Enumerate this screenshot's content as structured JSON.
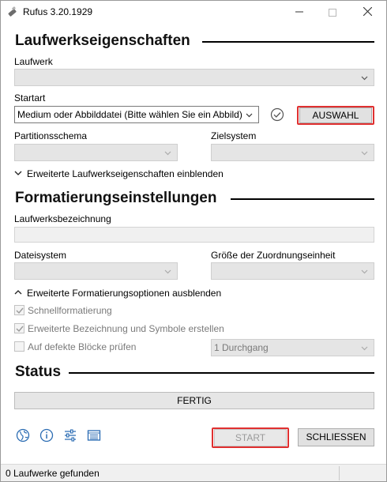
{
  "window": {
    "title": "Rufus 3.20.1929"
  },
  "drive_properties": {
    "heading": "Laufwerkseigenschaften",
    "device_label": "Laufwerk",
    "device_value": "",
    "boot_label": "Startart",
    "boot_value": "Medium oder Abbilddatei (Bitte wählen Sie ein Abbild)",
    "select_button": "AUSWAHL",
    "partition_label": "Partitionsschema",
    "target_label": "Zielsystem",
    "advanced_toggle": "Erweiterte Laufwerkseigenschaften einblenden"
  },
  "format_options": {
    "heading": "Formatierungseinstellungen",
    "volume_label": "Laufwerksbezeichnung",
    "volume_value": "",
    "filesystem_label": "Dateisystem",
    "cluster_label": "Größe der Zuordnungseinheit",
    "advanced_toggle": "Erweiterte Formatierungsoptionen ausblenden",
    "quick_format": {
      "label": "Schnellformatierung",
      "checked": true
    },
    "extended_label": {
      "label": "Erweiterte Bezeichnung und Symbole erstellen",
      "checked": true
    },
    "bad_blocks": {
      "label": "Auf defekte Blöcke prüfen",
      "checked": false
    },
    "passes_value": "1 Durchgang"
  },
  "status": {
    "heading": "Status",
    "progress_text": "FERTIG"
  },
  "toolbar": {
    "icons": [
      "globe-icon",
      "info-icon",
      "settings-sliders-icon",
      "log-icon"
    ],
    "start_button": "START",
    "close_button": "SCHLIESSEN"
  },
  "statusbar": {
    "text": "0 Laufwerke gefunden"
  },
  "colors": {
    "highlight": "#e03030",
    "disabled_fill": "#e5e5e5"
  }
}
